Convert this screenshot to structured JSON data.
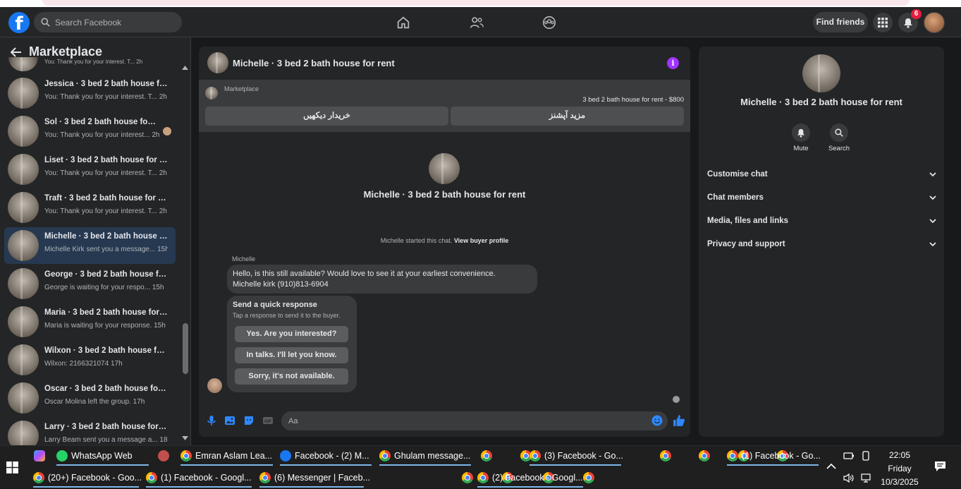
{
  "topbar": {
    "logo": "f",
    "search_placeholder": "Search Facebook",
    "find_friends": "Find friends",
    "notification_count": "6"
  },
  "sidebar": {
    "title": "Marketplace",
    "items": [
      {
        "name": "",
        "sub": "You: Thank you for your interest. T... 2h"
      },
      {
        "name": "Jessica · 3 bed 2 bath house for rent",
        "sub": "You: Thank you for your interest. T...",
        "time": "2h"
      },
      {
        "name": "Sol · 3 bed 2 bath house for rent",
        "sub": "You: Thank you for your interest...",
        "time": "2h"
      },
      {
        "name": "Liset · 3 bed 2 bath house for rent",
        "sub": "You: Thank you for your interest. T...",
        "time": "2h"
      },
      {
        "name": "Traft · 3 bed 2 bath house for rent",
        "sub": "You: Thank you for your interest. T...",
        "time": "2h"
      },
      {
        "name": "Michelle · 3 bed 2 bath house for rent",
        "sub": "Michelle Kirk sent you a message...",
        "time": "15h"
      },
      {
        "name": "George · 3 bed 2 bath house for rent",
        "sub": "George is waiting for your respo...",
        "time": "15h"
      },
      {
        "name": "Maria · 3 bed 2 bath house for rent",
        "sub": "Maria is waiting for your response.",
        "time": "15h"
      },
      {
        "name": "Wilxon · 3 bed 2 bath house for rent",
        "sub": "Wilxon: 2166321074",
        "time": "17h"
      },
      {
        "name": "Oscar · 3 bed 2 bath house for rent",
        "sub": "Oscar Molina left the group.",
        "time": "17h"
      },
      {
        "name": "Larry · 3 bed 2 bath house for rent",
        "sub": "Larry Beam sent you a message a...",
        "time": "18h"
      }
    ]
  },
  "chat": {
    "title": "Michelle · 3 bed 2 bath house for rent",
    "marketplace_label": "Marketplace",
    "listing": "3 bed 2 bath house for rent - $800",
    "btn_more_options": "مزید آپشنز",
    "btn_view_buyer": "خریدار دیکھیں",
    "center_name": "Michelle · 3 bed 2 bath house for rent",
    "started_text": "Michelle started this chat.",
    "view_buyer_profile": "View buyer profile",
    "sender": "Michelle",
    "message_line1": "Hello, is this still available? Would love to see it at your earliest convenience.",
    "message_line2": "Michelle kirk  (910)813-6904",
    "quick_title": "Send a quick response",
    "quick_sub": "Tap a response to send it to the buyer.",
    "quick_options": [
      "Yes. Are you interested?",
      "In talks. I'll let you know.",
      "Sorry, it's not available."
    ],
    "input_placeholder": "Aa"
  },
  "details": {
    "name": "Michelle · 3 bed 2 bath house for rent",
    "mute": "Mute",
    "search": "Search",
    "sections": [
      "Customise chat",
      "Chat members",
      "Media, files and links",
      "Privacy and support"
    ]
  },
  "taskbar": {
    "row1": [
      "WhatsApp Web",
      "Emran Aslam Lea...",
      "Facebook - (2) M...",
      "Ghulam message...",
      "(3) Facebook - Go...",
      "(1) Facebook - Go..."
    ],
    "row2": [
      "(20+) Facebook - Goo...",
      "(1) Facebook - Googl...",
      "(6) Messenger | Faceb...",
      "(2) Facebook - Googl..."
    ],
    "time": "22:05",
    "day": "Friday",
    "date": "10/3/2025"
  },
  "colors": {
    "accent": "#1877f2",
    "active_row": "#263951",
    "info": "#a033ff",
    "badge": "#e41e3f"
  }
}
